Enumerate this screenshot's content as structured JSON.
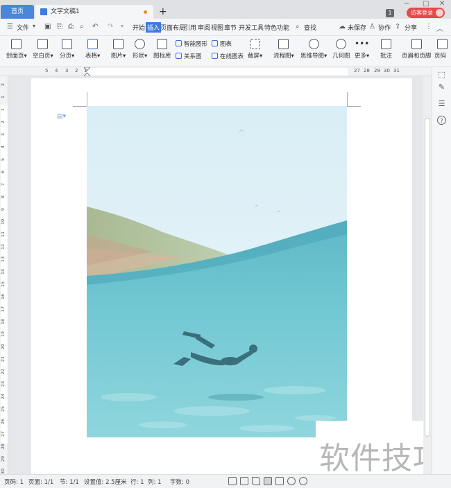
{
  "tabs": {
    "home": "首页",
    "document": "文字文稿1",
    "new_tab_symbol": "+"
  },
  "titlebar": {
    "notification_count": "1",
    "login_label": "访客登录",
    "minimize": "─",
    "maximize": "□",
    "close": "✕"
  },
  "menubar": {
    "file": "文件",
    "items": [
      "开始",
      "插入",
      "页面布局",
      "引用",
      "审阅",
      "视图",
      "章节",
      "开发工具",
      "特色功能"
    ],
    "active": "插入",
    "search": "查找",
    "unsaved": "未保存",
    "collaborate": "协作",
    "share": "分享"
  },
  "ribbon": {
    "cover": "封面页",
    "blank": "空白页",
    "page_break": "分页",
    "table": "表格",
    "picture": "图片",
    "shape": "形状",
    "icon_lib": "图标库",
    "smart_shape": "智能图形",
    "chart": "图表",
    "relation": "关系图",
    "online_chart": "在线图表",
    "screenshot": "截屏",
    "flowchart": "流程图",
    "mindmap": "思维导图",
    "geometry": "几何图",
    "more": "更多",
    "comment": "批注",
    "header_footer": "页眉和页脚",
    "page_num": "页码"
  },
  "ruler": {
    "left_numbers": [
      "5",
      "4",
      "3",
      "2",
      "1"
    ],
    "right_numbers": [
      "27",
      "28",
      "29",
      "30",
      "31"
    ],
    "vertical_numbers": [
      "2",
      "1",
      "1",
      "2",
      "3",
      "4",
      "5",
      "6",
      "7",
      "8",
      "9",
      "10",
      "11",
      "12",
      "13",
      "14",
      "15",
      "16",
      "17",
      "18",
      "19",
      "20",
      "21",
      "22",
      "23",
      "24",
      "25",
      "26",
      "27",
      "28",
      "29",
      "30"
    ]
  },
  "watermark": "软件技巧",
  "statusbar": {
    "page_num": "页码: 1",
    "pages": "页面: 1/1",
    "section": "节: 1/1",
    "setting": "设置值: 2.5厘米",
    "row": "行: 1",
    "col": "列: 1",
    "word_count": "字数: 0"
  },
  "colors": {
    "accent": "#3d7be0",
    "login": "#e8484a",
    "sky": "#dff1f7",
    "sea": "#6cc6d1"
  }
}
